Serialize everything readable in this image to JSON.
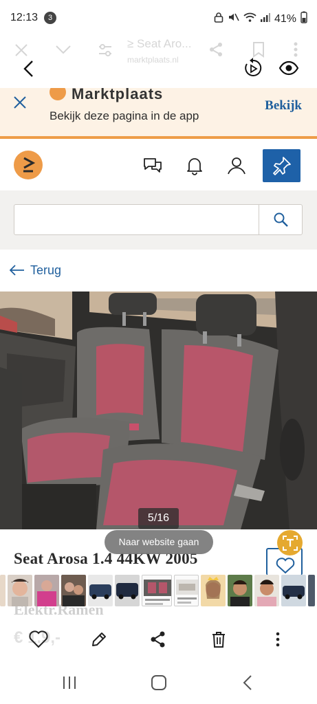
{
  "status_bar": {
    "time": "12:13",
    "notification_count": "3",
    "battery": "41%"
  },
  "browser_toolbar": {
    "page_title": "≥ Seat Aro...",
    "url": "marktplaats.nl"
  },
  "app_banner": {
    "brand": "Marktplaats",
    "message": "Bekijk deze pagina in de app",
    "open_label": "Bekijk"
  },
  "search": {
    "value": "",
    "placeholder": ""
  },
  "nav": {
    "back_label": "Terug"
  },
  "gallery": {
    "counter": "5/16",
    "thumbnail_count": 14
  },
  "listing": {
    "title": "Seat Arosa 1.4 44KW 2005",
    "subtitle": "Elektr.Ramen",
    "price": "€ 1.9,-"
  },
  "overlay": {
    "toast": "Naar website gaan"
  },
  "colors": {
    "brand_orange": "#ee9b48",
    "brand_blue": "#1e61a8",
    "banner_bg": "#fdf2e5"
  }
}
